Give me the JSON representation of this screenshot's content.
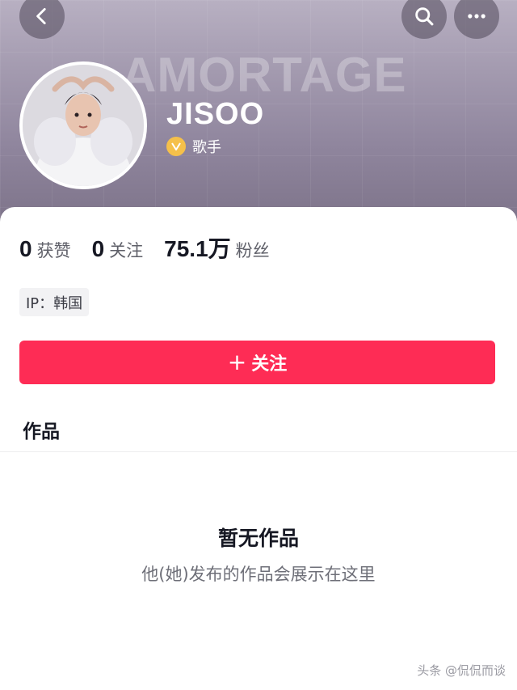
{
  "header": {
    "cover_text": "AMORTAGE",
    "back_icon": "chevron-left-icon",
    "search_icon": "search-icon",
    "more_icon": "more-dots-icon"
  },
  "profile": {
    "name": "JISOO",
    "verify_badge": "V",
    "verify_label": "歌手"
  },
  "stats": {
    "likes_count": "0",
    "likes_label": "获赞",
    "following_count": "0",
    "following_label": "关注",
    "followers_count": "75.1万",
    "followers_label": "粉丝"
  },
  "ip_tag": "IP：韩国",
  "follow_button": {
    "plus": "+",
    "label": "关注"
  },
  "works": {
    "title": "作品",
    "empty_title": "暂无作品",
    "empty_subtitle": "他(她)发布的作品会展示在这里"
  },
  "watermark": "头条 @侃侃而谈",
  "colors": {
    "accent": "#fe2c55",
    "verify": "#f5c04a"
  }
}
